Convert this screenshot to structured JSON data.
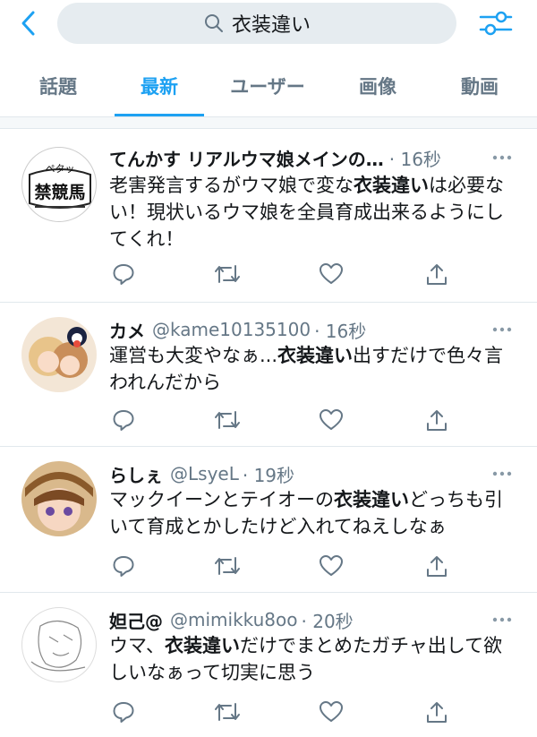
{
  "search": {
    "query": "衣装違い"
  },
  "tabs": [
    {
      "label": "話題"
    },
    {
      "label": "最新"
    },
    {
      "label": "ユーザー"
    },
    {
      "label": "画像"
    },
    {
      "label": "動画"
    }
  ],
  "active_tab": "最新",
  "colors": {
    "accent": "#1da1f2",
    "secondary_text": "#657786",
    "divider": "#e1e8ed"
  },
  "tweets": [
    {
      "name": "てんかす リアルウマ娘メインの…",
      "handle": "",
      "time": "· 16秒",
      "avatar_text": [
        "ペタッ",
        "禁競馬"
      ],
      "text_before": "老害発言するがウマ娘で変な",
      "highlight": "衣装違い",
      "text_after": "は必要ない！現状いるウマ娘を全員育成出来るようにしてくれ！"
    },
    {
      "name": "カメ",
      "handle": "@kame10135100",
      "time": "· 16秒",
      "text_before": "運営も大変やなぁ...",
      "highlight": "衣装違い",
      "text_after": "出すだけで色々言われんだから"
    },
    {
      "name": "らしぇ",
      "handle": "@LsyeL",
      "time": "· 19秒",
      "text_before": "マックイーンとテイオーの",
      "highlight": "衣装違い",
      "text_after": "どっちも引いて育成とかしたけど入れてねえしなぁ"
    },
    {
      "name": "妲己@",
      "handle": "@mimikku8oo",
      "time": "· 20秒",
      "text_before": "ウマ、",
      "highlight": "衣装違い",
      "text_after": "だけでまとめたガチャ出して欲しいなぁって切実に思う"
    }
  ],
  "icons": {
    "back": "chevron-left-icon",
    "search": "search-icon",
    "filter": "filter-sliders-icon",
    "more": "more-dots-icon",
    "reply": "reply-icon",
    "retweet": "retweet-icon",
    "like": "heart-icon",
    "share": "share-icon"
  }
}
